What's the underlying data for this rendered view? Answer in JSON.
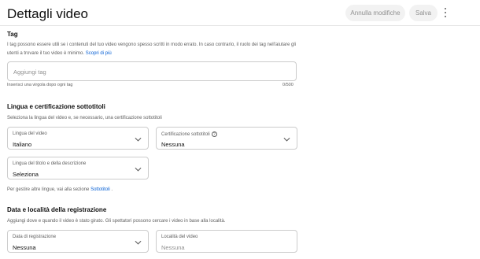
{
  "header": {
    "title": "Dettagli video",
    "undo_label": "Annulla modifiche",
    "save_label": "Salva"
  },
  "tags": {
    "title": "Tag",
    "description": "I tag possono essere utili se i contenuti del tuo video vengono spesso scritti in modo errato. In caso contrario, il ruolo dei tag nell'aiutare gli utenti a trovare il tuo video è minimo.",
    "learn_more": "Scopri di più",
    "placeholder": "Aggiungi tag",
    "helper": "Inserisci una virgola dopo ogni tag",
    "counter": "0/500"
  },
  "language": {
    "title": "Lingua e certificazione sottotitoli",
    "description": "Seleziona la lingua del video e, se necessario, una certificazione sottotitoli",
    "video_language": {
      "label": "Lingua del video",
      "value": "Italiano"
    },
    "caption_cert": {
      "label": "Certificazione sottotitoli",
      "value": "Nessuna"
    },
    "title_language": {
      "label": "Lingua del titolo e della descrizione",
      "value": "Seleziona"
    },
    "manage_text": "Per gestire altre lingue, vai alla sezione",
    "manage_link": "Sottotitoli"
  },
  "recording": {
    "title": "Data e località della registrazione",
    "description": "Aggiungi dove e quando il video è stato girato. Gli spettatori possono cercare i video in base alla località.",
    "date": {
      "label": "Data di registrazione",
      "value": "Nessuna"
    },
    "location": {
      "label": "Località del video",
      "placeholder": "Nessuna"
    }
  }
}
